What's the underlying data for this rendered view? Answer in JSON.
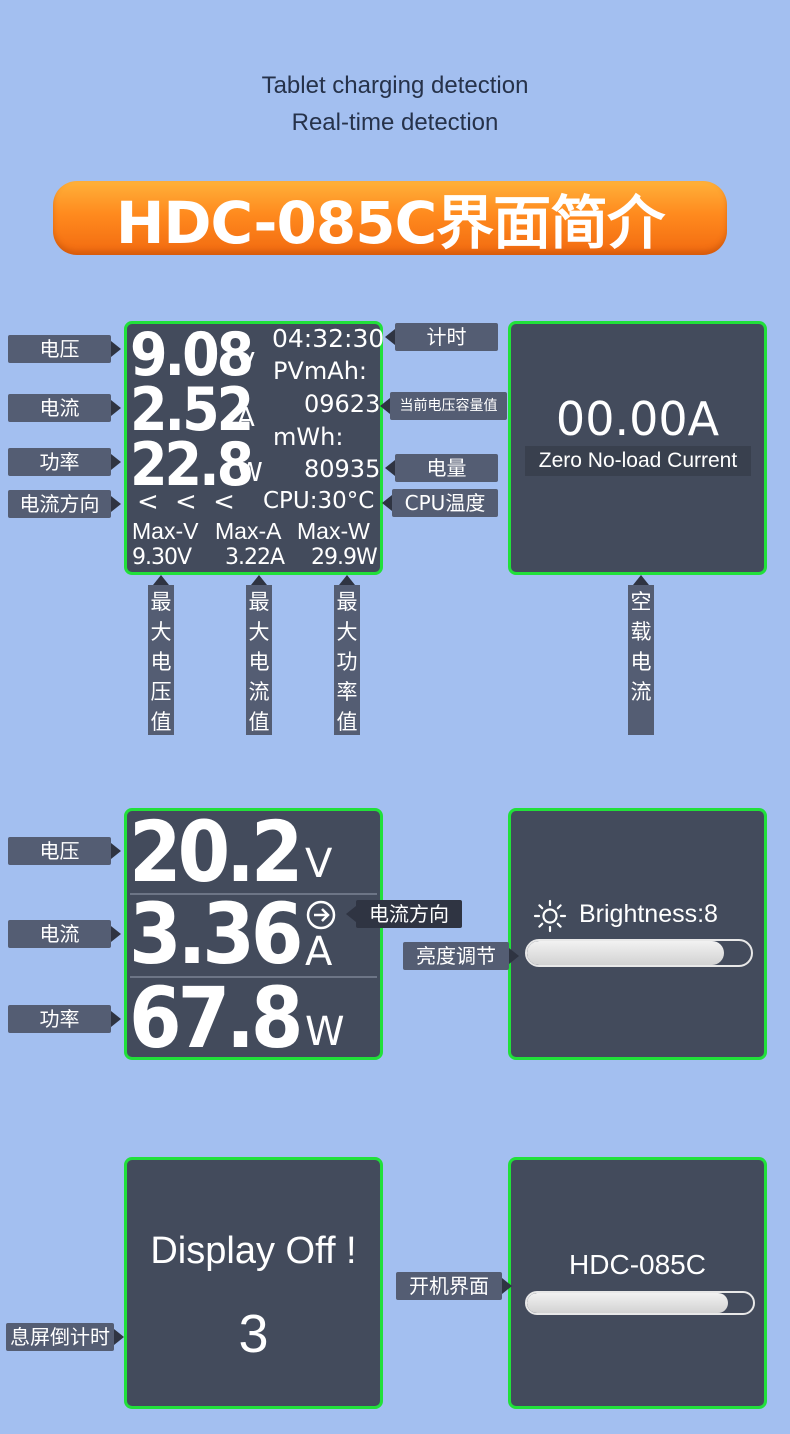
{
  "header": {
    "line1": "Tablet charging detection",
    "line2": "Real-time detection",
    "banner": "HDC-085C界面简介"
  },
  "screen1": {
    "voltage": "9.08",
    "voltage_unit": "V",
    "current": "2.52",
    "current_unit": "A",
    "power": "22.8",
    "power_unit": "W",
    "direction": "< < <",
    "timer": "04:32:30",
    "pvmah_label": "PVmAh:",
    "pvmah_value": "09623",
    "mwh_label": "mWh:",
    "mwh_value": "80935",
    "cpu": "CPU:30°C",
    "max_v_label": "Max-V",
    "max_a_label": "Max-A",
    "max_w_label": "Max-W",
    "max_v": "9.30V",
    "max_a": "3.22A",
    "max_w": "29.9W"
  },
  "screen2": {
    "value": "00.00A",
    "caption": "Zero No-load Current"
  },
  "screen3": {
    "voltage": "20.2",
    "voltage_unit": "V",
    "current": "3.36",
    "current_unit": "A",
    "power": "67.8",
    "power_unit": "W"
  },
  "screen4": {
    "brightness": "Brightness:8",
    "brightness_level": 0.88
  },
  "screen5": {
    "line1": "Display Off !",
    "countdown": "3"
  },
  "screen6": {
    "title": "HDC-085C",
    "progress": 0.89
  },
  "labels": {
    "voltage": "电压",
    "current": "电流",
    "power": "功率",
    "direction": "电流方向",
    "timer": "计时",
    "capacity": "当前电压容量值",
    "energy": "电量",
    "cpu_temp": "CPU温度",
    "max_v": "最大电压值",
    "max_a": "最大电流值",
    "max_w": "最大功率值",
    "zero_current": "空载电流",
    "voltage2": "电压",
    "current2": "电流",
    "power2": "功率",
    "direction2": "电流方向",
    "brightness_adj": "亮度调节",
    "screen_off": "息屏倒计时",
    "boot": "开机界面"
  }
}
